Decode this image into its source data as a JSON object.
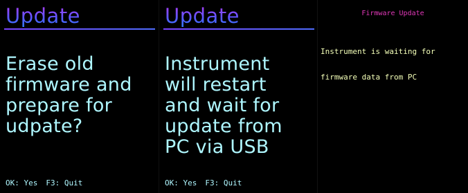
{
  "screens": [
    {
      "title": "Update",
      "body_lines": [
        "Erase old",
        "firmware and",
        "prepare for",
        "udpate?"
      ],
      "footer": {
        "ok_label": "OK: Yes",
        "quit_label": "F3: Quit"
      }
    },
    {
      "title": "Update",
      "body_lines": [
        "Instrument",
        "will restart",
        "and wait for",
        "update from",
        "PC via USB"
      ],
      "footer": {
        "ok_label": "OK: Yes",
        "quit_label": "F3: Quit"
      }
    },
    {
      "title": "Firmware Update",
      "message_lines": [
        "Instrument is waiting for",
        "firmware data from PC"
      ]
    }
  ],
  "colors": {
    "background": "#000000",
    "title_gradient": [
      "#b83cff",
      "#2f7bff"
    ],
    "body_text": "#aff7ff",
    "small_title": "#e038b8",
    "message_text": "#f4ffb8"
  }
}
